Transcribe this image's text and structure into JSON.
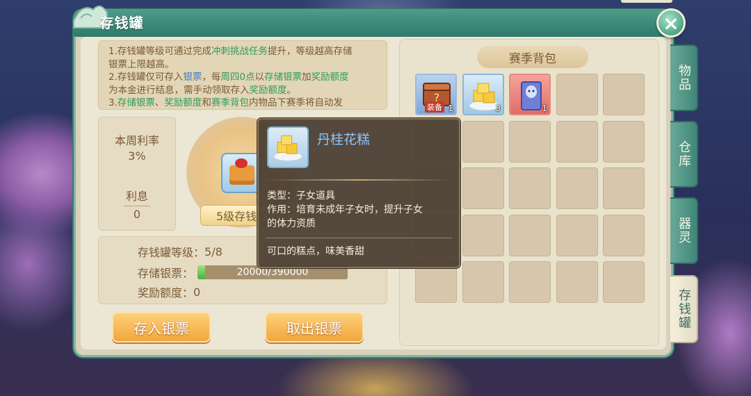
{
  "window": {
    "title": "存钱罐",
    "close_icon": "×"
  },
  "info_note": {
    "line1_a": "1.存钱罐等级可通过完成",
    "line1_b": "冲刺挑战任务",
    "line1_c": "提升，等级越高存储",
    "line2": "银票上限越高。",
    "line3_a": "2.存钱罐仅可存入",
    "line3_b": "银票",
    "line3_c": "，每",
    "line3_d": "周四0点",
    "line3_e": "以",
    "line3_f": "存储银票",
    "line3_g": "加",
    "line3_h": "奖励额度",
    "line4_a": "为本金进行结息，需手动领取存入",
    "line4_b": "奖励额度",
    "line4_c": "。",
    "line5_a": "3.",
    "line5_b": "存储银票",
    "line5_c": "、",
    "line5_d": "奖励额度",
    "line5_e": "和",
    "line5_f": "赛季背包",
    "line5_g": "内物品下赛季将自动发"
  },
  "rate_panel": {
    "rate_label": "本周利率",
    "rate_value": "3%",
    "interest_label": "利息",
    "interest_value": "0"
  },
  "piggy": {
    "level_banner": "5级存钱"
  },
  "stats": {
    "level_label": "存钱罐等级：",
    "level_value": "5/8",
    "stored_label": "存储银票：",
    "stored_text": "20000/390000",
    "stored_fraction": 0.0513,
    "reward_label": "奖励额度：",
    "reward_value": "0"
  },
  "buttons": {
    "deposit": "存入银票",
    "withdraw": "取出银票"
  },
  "bag": {
    "title": "赛季背包",
    "items": [
      {
        "name": "装备宝箱",
        "icon": "equipment-chest-icon",
        "tag": "装备",
        "count": "1"
      },
      {
        "name": "丹桂花糕",
        "icon": "osmanthus-cake-icon",
        "count": "3"
      },
      {
        "name": "精灵卷轴",
        "icon": "spirit-scroll-icon",
        "count": "1"
      }
    ]
  },
  "side_tabs": [
    {
      "label": "物品"
    },
    {
      "label": "仓库"
    },
    {
      "label": "器灵"
    },
    {
      "label": "存钱罐"
    }
  ],
  "tooltip": {
    "item_name": "丹桂花糕",
    "type_line": "类型：子女道具",
    "effect_line1": "作用：培育未成年子女时，提升子女",
    "effect_line2": "的体力资质",
    "desc": "可口的糕点，味美香甜"
  },
  "colors": {
    "frame_teal": "#3f8676",
    "highlight_green": "#2f9a5e",
    "highlight_blue": "#3e7bc8",
    "button_orange": "#f2a63c",
    "tooltip_name": "#8fc2ff"
  }
}
